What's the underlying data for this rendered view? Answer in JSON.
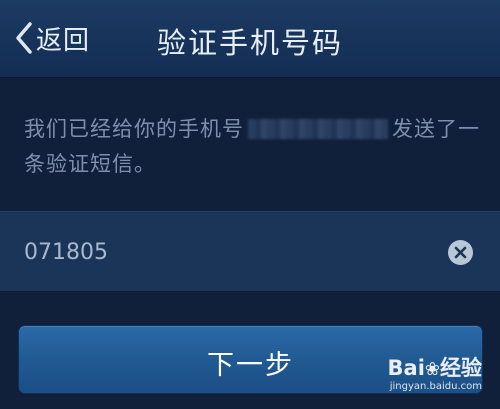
{
  "header": {
    "back_label": "返回",
    "title": "验证手机号码"
  },
  "message": {
    "before": "我们已经给你的手机号",
    "after": "发送了一条验证短信。"
  },
  "code_input": {
    "value": "071805"
  },
  "next_button": {
    "label": "下一步"
  },
  "watermark": {
    "logo_left": "Bai",
    "logo_right": "经验",
    "url": "jingyan.baidu.com"
  },
  "colors": {
    "background": "#10203b",
    "header": "#1a365c",
    "input_row": "#1b3559",
    "button": "#215a93"
  },
  "icons": [
    "chevron-left-icon",
    "clear-icon",
    "baidu-paw-icon"
  ]
}
